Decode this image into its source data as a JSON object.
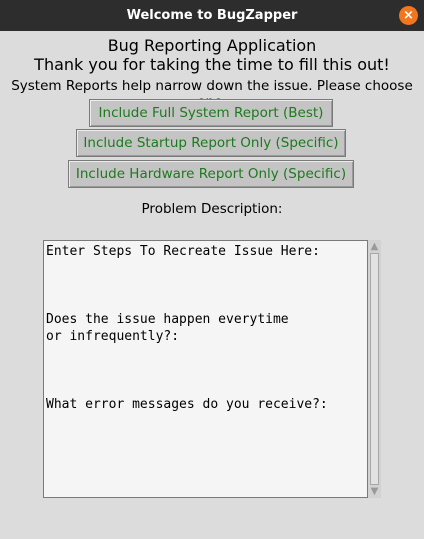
{
  "window": {
    "title": "Welcome to BugZapper",
    "close_icon": "×"
  },
  "header": {
    "title": "Bug Reporting Application",
    "thanks": "Thank you for taking the time to fill this out!",
    "instructions": "System Reports help narrow down the issue. Please choose one."
  },
  "buttons": {
    "full_report": "Include Full System Report (Best)",
    "startup_report": "Include Startup Report Only (Specific)",
    "hardware_report": "Include Hardware Report Only (Specific)"
  },
  "problem": {
    "label": "Problem Description:",
    "text": "Enter Steps To Recreate Issue Here:\n\n\n\nDoes the issue happen everytime\nor infrequently?:\n\n\n\nWhat error messages do you receive?:"
  },
  "colors": {
    "button_text": "#1d7a1d",
    "close_button": "#f0761f",
    "titlebar": "#2d2d2d"
  }
}
